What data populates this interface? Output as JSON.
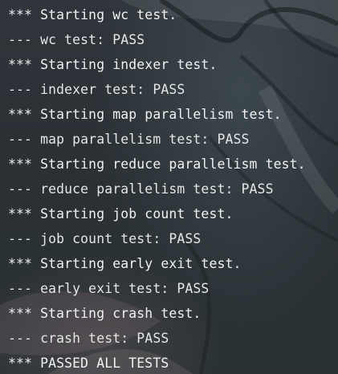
{
  "terminal": {
    "lines": [
      {
        "text": "*** Starting wc test."
      },
      {
        "text": "--- wc test: PASS"
      },
      {
        "text": "*** Starting indexer test."
      },
      {
        "text": "--- indexer test: PASS"
      },
      {
        "text": "*** Starting map parallelism test."
      },
      {
        "text": "--- map parallelism test: PASS"
      },
      {
        "text": "*** Starting reduce parallelism test."
      },
      {
        "text": "--- reduce parallelism test: PASS"
      },
      {
        "text": "*** Starting job count test."
      },
      {
        "text": "--- job count test: PASS"
      },
      {
        "text": "*** Starting early exit test."
      },
      {
        "text": "--- early exit test: PASS"
      },
      {
        "text": "*** Starting crash test."
      },
      {
        "text": "--- crash test: PASS"
      },
      {
        "text": "*** PASSED ALL TESTS"
      }
    ]
  },
  "colors": {
    "background": "#2b3136",
    "text": "#f2f2f2"
  }
}
